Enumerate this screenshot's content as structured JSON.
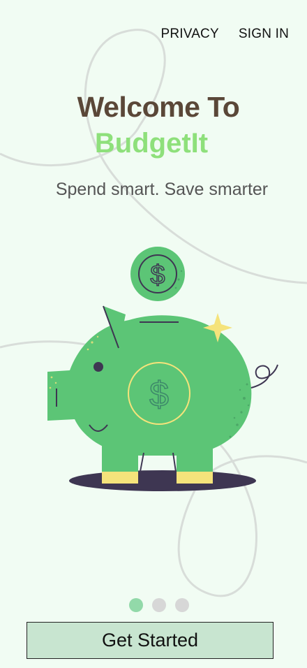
{
  "nav": {
    "privacy": "PRIVACY",
    "sign_in": "SIGN IN"
  },
  "hero": {
    "title": "Welcome To",
    "brand": "BudgetIt",
    "tagline": "Spend smart. Save smarter"
  },
  "illustration": {
    "coin_symbol": "$",
    "belly_symbol": "$"
  },
  "pagination": {
    "total": 3,
    "active_index": 0
  },
  "cta": {
    "label": "Get Started"
  },
  "colors": {
    "background": "#f1fcf3",
    "title": "#5a4738",
    "brand": "#8ee07b",
    "pig_green": "#5cc576",
    "accent_yellow": "#f5e37b",
    "shadow": "#3e3652",
    "button_bg": "#c8e5d0",
    "dot_active": "#92d9a9",
    "dot_inactive": "#d7d7d7"
  }
}
